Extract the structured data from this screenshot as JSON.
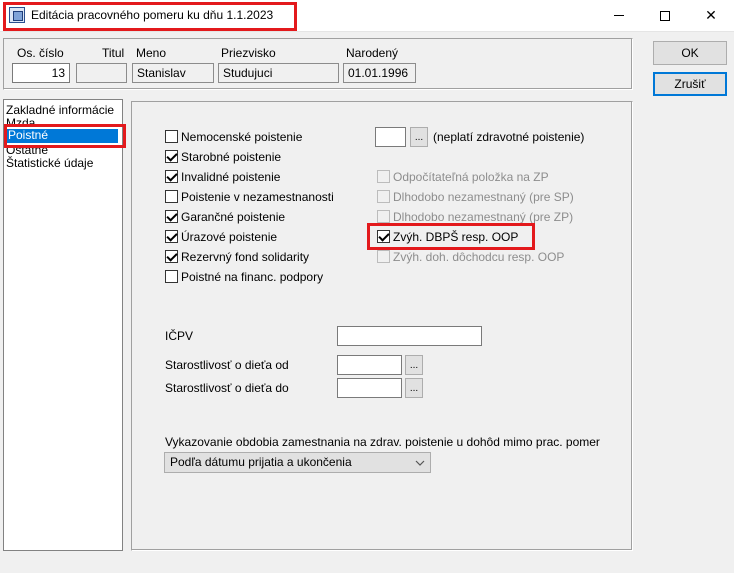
{
  "window": {
    "title": "Editácia pracovného pomeru ku dňu  1.1.2023",
    "minimize_icon": "minimize-icon",
    "maximize_icon": "maximize-icon",
    "close_icon": "close-icon",
    "close_glyph": "✕"
  },
  "header": {
    "os_cislo_label": "Os. číslo",
    "os_cislo_value": "13",
    "titul_label": "Titul",
    "titul_value": "",
    "meno_label": "Meno",
    "meno_value": "Stanislav",
    "priezvisko_label": "Priezvisko",
    "priezvisko_value": "Studujuci",
    "narodeny_label": "Narodený",
    "narodeny_value": "01.01.1996"
  },
  "buttons": {
    "ok": "OK",
    "cancel": "Zrušiť"
  },
  "sections": [
    "Zakladné informácie",
    "Mzda",
    "Poistné",
    "Ostatné",
    "Štatistické údaje"
  ],
  "selected_section": "Poistné",
  "left_checkboxes": [
    {
      "label": "Nemocenské poistenie",
      "checked": false
    },
    {
      "label": "Starobné poistenie",
      "checked": true
    },
    {
      "label": "Invalidné poistenie",
      "checked": true
    },
    {
      "label": "Poistenie v nezamestnanosti",
      "checked": false
    },
    {
      "label": "Garančné poistenie",
      "checked": true
    },
    {
      "label": "Úrazové poistenie",
      "checked": true
    },
    {
      "label": "Rezervný fond solidarity",
      "checked": true
    },
    {
      "label": "Poistné na financ. podpory",
      "checked": false
    }
  ],
  "zp": {
    "value": "",
    "button": "...",
    "label": "(neplatí zdravotné poistenie)"
  },
  "right_checkboxes": [
    {
      "label": "Odpočítateľná položka na ZP",
      "checked": false,
      "enabled": false
    },
    {
      "label": "Dlhodobo nezamestnaný (pre SP)",
      "checked": false,
      "enabled": false
    },
    {
      "label": "Dlhodobo nezamestnaný (pre ZP)",
      "checked": false,
      "enabled": false
    },
    {
      "label": "Zvýh. DBPŠ resp. OOP",
      "checked": true,
      "enabled": true
    },
    {
      "label": "Zvýh. doh. dôchodcu resp. OOP",
      "checked": false,
      "enabled": false
    }
  ],
  "form": {
    "icpv_label": "IČPV",
    "icpv_value": "",
    "starost_od_label": "Starostlivosť o dieťa od",
    "starost_od_value": "",
    "starost_do_label": "Starostlivosť o dieťa do",
    "starost_do_value": "",
    "picker_button": "..."
  },
  "vykazovanie": {
    "label": "Vykazovanie obdobia zamestnania na zdrav. poistenie u dohôd mimo prac. pomer",
    "selected": "Podľa dátumu prijatia a ukončenia"
  }
}
